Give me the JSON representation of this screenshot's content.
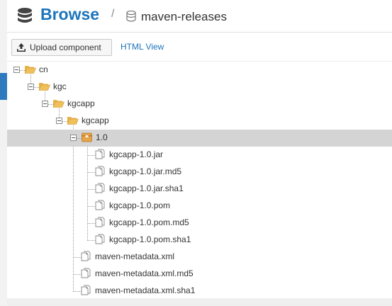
{
  "header": {
    "title": "Browse",
    "separator": "/",
    "repository": "maven-releases"
  },
  "toolbar": {
    "upload_label": "Upload component",
    "html_view_label": "HTML View"
  },
  "tree": [
    {
      "label": "cn",
      "type": "folder",
      "depth": 0,
      "expanded": true
    },
    {
      "label": "kgc",
      "type": "folder",
      "depth": 1,
      "expanded": true
    },
    {
      "label": "kgcapp",
      "type": "folder",
      "depth": 2,
      "expanded": true
    },
    {
      "label": "kgcapp",
      "type": "folder",
      "depth": 3,
      "expanded": true
    },
    {
      "label": "1.0",
      "type": "component",
      "depth": 4,
      "expanded": true,
      "selected": true
    },
    {
      "label": "kgcapp-1.0.jar",
      "type": "file",
      "depth": 5
    },
    {
      "label": "kgcapp-1.0.jar.md5",
      "type": "file",
      "depth": 5
    },
    {
      "label": "kgcapp-1.0.jar.sha1",
      "type": "file",
      "depth": 5
    },
    {
      "label": "kgcapp-1.0.pom",
      "type": "file",
      "depth": 5
    },
    {
      "label": "kgcapp-1.0.pom.md5",
      "type": "file",
      "depth": 5
    },
    {
      "label": "kgcapp-1.0.pom.sha1",
      "type": "file",
      "depth": 5
    },
    {
      "label": "maven-metadata.xml",
      "type": "file",
      "depth": 4
    },
    {
      "label": "maven-metadata.xml.md5",
      "type": "file",
      "depth": 4
    },
    {
      "label": "maven-metadata.xml.sha1",
      "type": "file",
      "depth": 4
    }
  ],
  "colors": {
    "accent": "#1c74bb",
    "folder": "#f0c05a",
    "component": "#e6a44a",
    "selected_row": "#d4d4d4"
  },
  "icons": {
    "header": "database-icon",
    "repository": "repository-icon",
    "upload": "upload-icon",
    "folder": "folder-open-icon",
    "component": "component-icon",
    "file": "file-icon"
  }
}
